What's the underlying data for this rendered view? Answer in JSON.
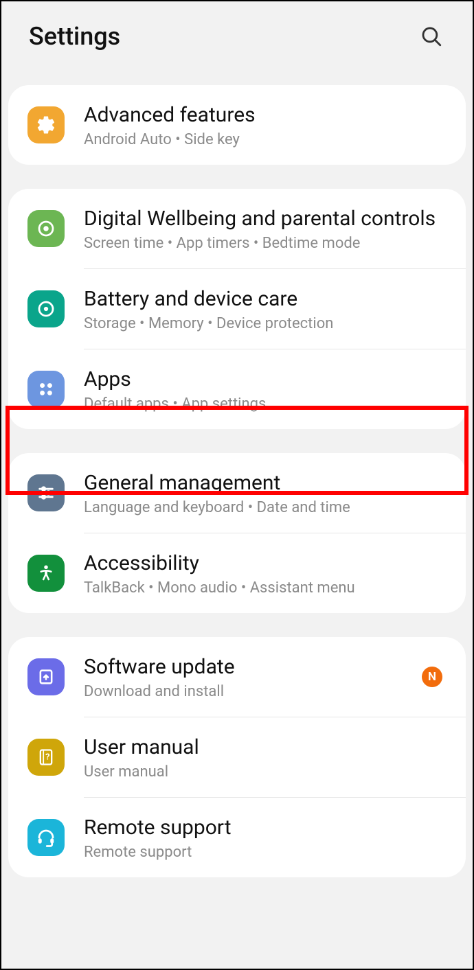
{
  "header": {
    "title": "Settings"
  },
  "groups": [
    {
      "items": [
        {
          "id": "advanced",
          "title": "Advanced features",
          "sub": "Android Auto  •  Side key"
        }
      ]
    },
    {
      "items": [
        {
          "id": "wellbeing",
          "title": "Digital Wellbeing and parental controls",
          "sub": "Screen time  •  App timers  •  Bedtime mode"
        },
        {
          "id": "battery",
          "title": "Battery and device care",
          "sub": "Storage  •  Memory  •  Device protection"
        },
        {
          "id": "apps",
          "title": "Apps",
          "sub": "Default apps  •  App settings",
          "highlighted": true
        }
      ]
    },
    {
      "items": [
        {
          "id": "general",
          "title": "General management",
          "sub": "Language and keyboard  •  Date and time"
        },
        {
          "id": "accessibility",
          "title": "Accessibility",
          "sub": "TalkBack  •  Mono audio  •  Assistant menu"
        }
      ]
    },
    {
      "items": [
        {
          "id": "software",
          "title": "Software update",
          "sub": "Download and install",
          "badge": "N"
        },
        {
          "id": "manual",
          "title": "User manual",
          "sub": "User manual"
        },
        {
          "id": "remote",
          "title": "Remote support",
          "sub": "Remote support"
        }
      ]
    }
  ]
}
